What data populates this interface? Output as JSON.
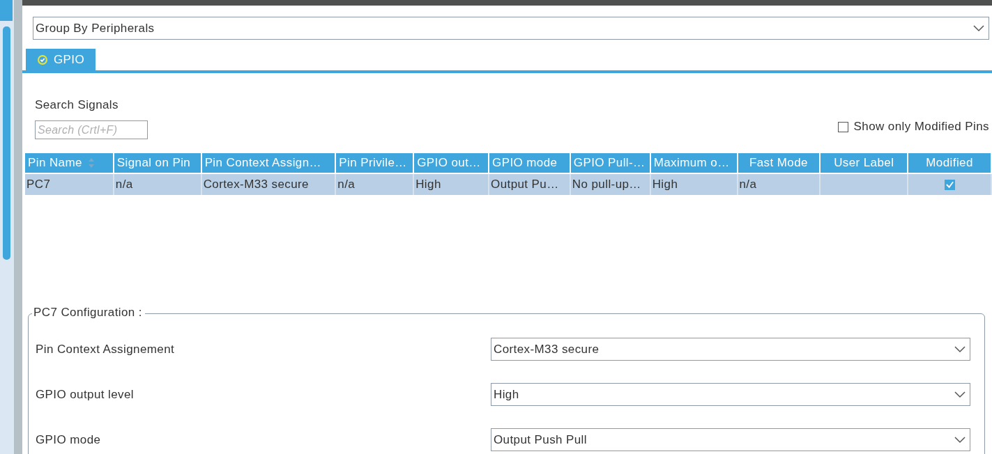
{
  "group_select": {
    "value": "Group By Peripherals"
  },
  "tabs": [
    {
      "label": "GPIO",
      "selected": true
    }
  ],
  "search": {
    "label": "Search Signals",
    "placeholder": "Search (Crtl+F)"
  },
  "show_modified": {
    "label": "Show only Modified Pins",
    "checked": false
  },
  "table": {
    "columns": [
      {
        "label": "Pin Name",
        "kind": "sortable"
      },
      {
        "label": "Signal on Pin",
        "kind": "plain"
      },
      {
        "label": "Pin Context Assign…",
        "kind": "plain"
      },
      {
        "label": "Pin Privile…",
        "kind": "plain"
      },
      {
        "label": "GPIO out…",
        "kind": "plain"
      },
      {
        "label": "GPIO mode",
        "kind": "plain"
      },
      {
        "label": "GPIO Pull-…",
        "kind": "plain"
      },
      {
        "label": "Maximum o…",
        "kind": "plain"
      },
      {
        "label": "Fast Mode",
        "kind": "center"
      },
      {
        "label": "User Label",
        "kind": "center"
      },
      {
        "label": "Modified",
        "kind": "center"
      }
    ],
    "rows": [
      {
        "selected": true,
        "cells": [
          "PC7",
          "n/a",
          "Cortex-M33 secure",
          "n/a",
          "High",
          "Output Pu…",
          "No pull-up…",
          "High",
          "n/a",
          ""
        ],
        "modified": true
      }
    ]
  },
  "config": {
    "title": "PC7 Configuration :",
    "fields": [
      {
        "label": "Pin Context Assignement",
        "value": "Cortex-M33 secure"
      },
      {
        "label": "GPIO output level",
        "value": "High"
      },
      {
        "label": "GPIO mode",
        "value": "Output Push Pull"
      }
    ]
  }
}
